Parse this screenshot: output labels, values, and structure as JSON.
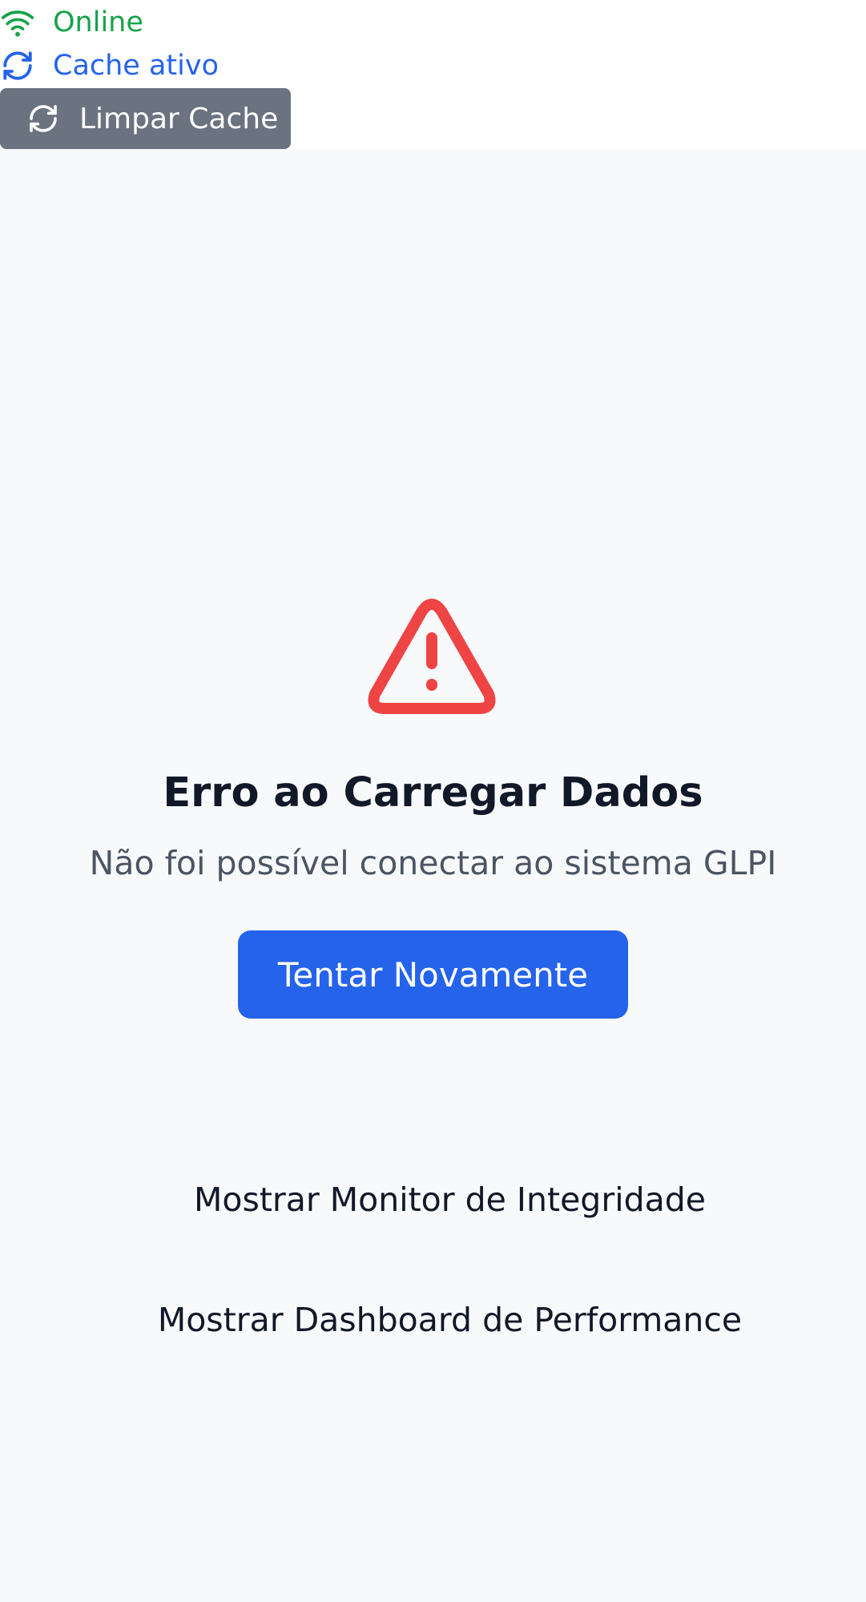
{
  "status": {
    "online_label": "Online",
    "online_icon": "wifi-icon",
    "online_color": "#16a34a",
    "cache_label": "Cache ativo",
    "cache_icon": "refresh-icon",
    "cache_color": "#2563eb"
  },
  "toolbar": {
    "clear_cache_label": "Limpar Cache",
    "clear_cache_icon": "refresh-icon",
    "clear_cache_color": "#6b7280"
  },
  "error": {
    "icon": "warning-triangle-icon",
    "icon_color": "#ef4444",
    "title": "Erro ao Carregar Dados",
    "message": "Não foi possível conectar ao sistema GLPI",
    "retry_label": "Tentar Novamente",
    "retry_color": "#2563eb"
  },
  "toggles": {
    "integrity_label": "Mostrar Monitor de Integridade",
    "performance_label": "Mostrar Dashboard de Performance"
  }
}
